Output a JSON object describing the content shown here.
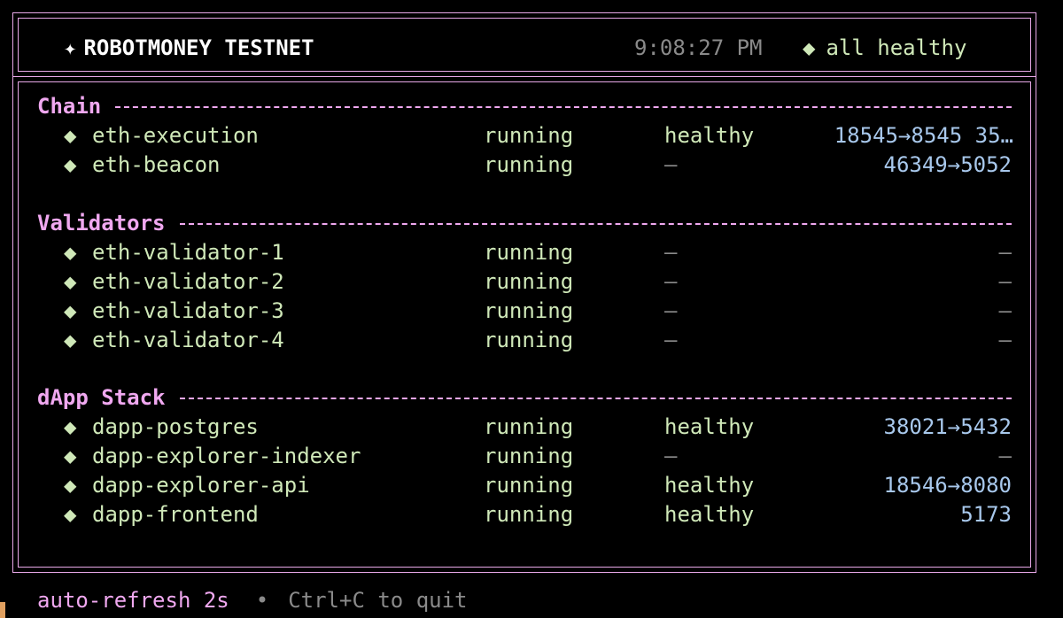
{
  "header": {
    "star_glyph": "✦",
    "title": "ROBOTMONEY TESTNET",
    "clock": "9:08:27 PM",
    "status_glyph": "◆",
    "status_text": "all healthy"
  },
  "sections": [
    {
      "name": "Chain",
      "services": [
        {
          "glyph": "◆",
          "name": "eth-execution",
          "state": "running",
          "health": "healthy",
          "ports": "18545→8545  35…"
        },
        {
          "glyph": "◆",
          "name": "eth-beacon",
          "state": "running",
          "health": "–",
          "ports": "46349→5052"
        }
      ]
    },
    {
      "name": "Validators",
      "services": [
        {
          "glyph": "◆",
          "name": "eth-validator-1",
          "state": "running",
          "health": "–",
          "ports": "–"
        },
        {
          "glyph": "◆",
          "name": "eth-validator-2",
          "state": "running",
          "health": "–",
          "ports": "–"
        },
        {
          "glyph": "◆",
          "name": "eth-validator-3",
          "state": "running",
          "health": "–",
          "ports": "–"
        },
        {
          "glyph": "◆",
          "name": "eth-validator-4",
          "state": "running",
          "health": "–",
          "ports": "–"
        }
      ]
    },
    {
      "name": "dApp Stack",
      "services": [
        {
          "glyph": "◆",
          "name": "dapp-postgres",
          "state": "running",
          "health": "healthy",
          "ports": "38021→5432"
        },
        {
          "glyph": "◆",
          "name": "dapp-explorer-indexer",
          "state": "running",
          "health": "–",
          "ports": "–"
        },
        {
          "glyph": "◆",
          "name": "dapp-explorer-api",
          "state": "running",
          "health": "healthy",
          "ports": "18546→8080"
        },
        {
          "glyph": "◆",
          "name": "dapp-frontend",
          "state": "running",
          "health": "healthy",
          "ports": "5173"
        }
      ]
    }
  ],
  "footer": {
    "refresh": "auto-refresh 2s",
    "separator": "•",
    "hint": "Ctrl+C to quit"
  },
  "colors": {
    "border": "#e8a8e8",
    "section": "#f0a8f0",
    "text": "#cfe8b8",
    "ports": "#a8c8ec",
    "muted": "#8a8a8a",
    "background": "#000000"
  }
}
